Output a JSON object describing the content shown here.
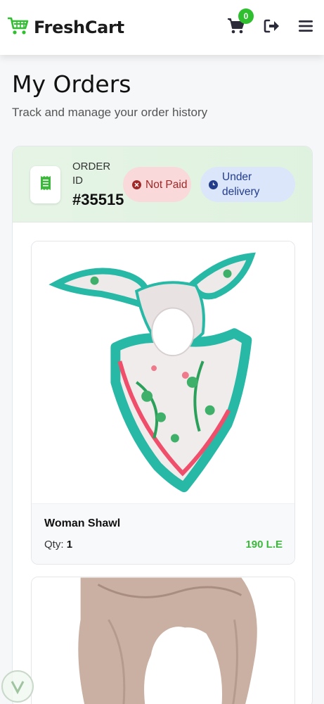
{
  "brand": {
    "name": "FreshCart",
    "logo_icon": "shopping-cart-icon",
    "accent": "#2fbf2f"
  },
  "nav": {
    "cart_count": "0",
    "cart_icon": "cart-icon",
    "logout_icon": "logout-icon",
    "menu_icon": "hamburger-menu-icon"
  },
  "page": {
    "title": "My Orders",
    "subtitle": "Track and manage your order history"
  },
  "order": {
    "id_label": "ORDER ID",
    "id": "#35515",
    "payment_status": "Not Paid",
    "delivery_status": "Under delivery",
    "colors": {
      "unpaid": "#a12828",
      "delivery": "#233c8c",
      "price": "#3bb93b"
    },
    "items": [
      {
        "name": "Woman Shawl",
        "qty_label": "Qty:",
        "qty": "1",
        "price": "190 L.E"
      },
      {
        "name": "",
        "qty_label": "",
        "qty": "",
        "price": ""
      }
    ]
  }
}
